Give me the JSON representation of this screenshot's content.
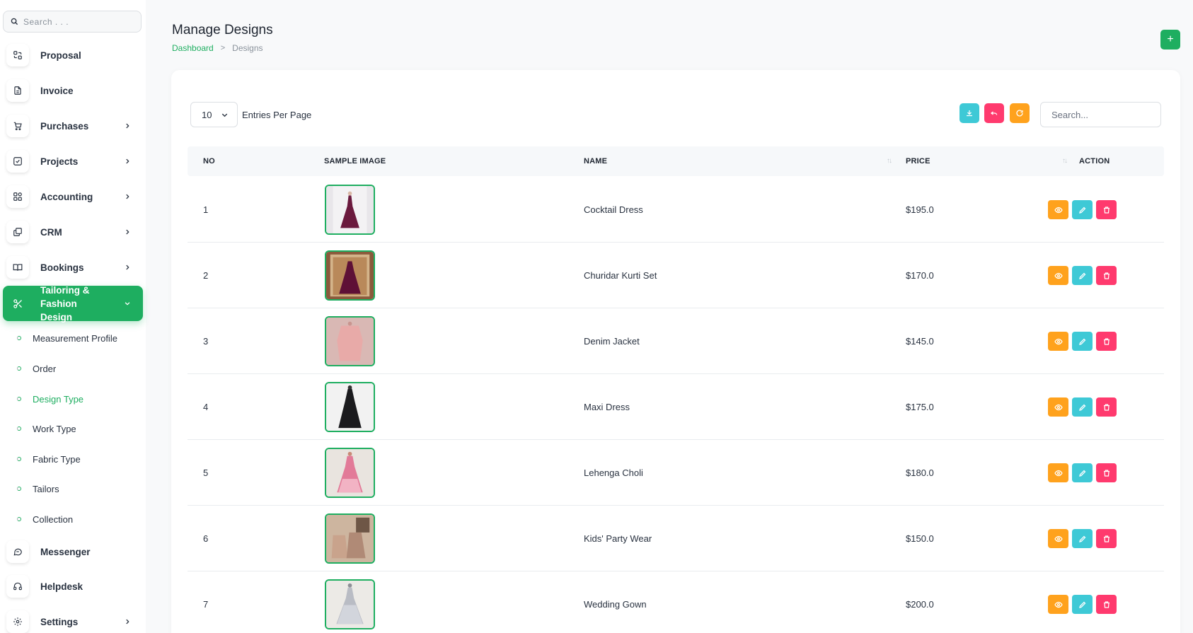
{
  "sidebar": {
    "search_placeholder": "Search . . .",
    "items": [
      {
        "label": "Proposal",
        "icon": "proposal-icon",
        "has_chevron": false
      },
      {
        "label": "Invoice",
        "icon": "invoice-icon",
        "has_chevron": false
      },
      {
        "label": "Purchases",
        "icon": "cart-icon",
        "has_chevron": true
      },
      {
        "label": "Projects",
        "icon": "checkbox-icon",
        "has_chevron": true
      },
      {
        "label": "Accounting",
        "icon": "grid-icon",
        "has_chevron": true
      },
      {
        "label": "CRM",
        "icon": "layers-icon",
        "has_chevron": true
      },
      {
        "label": "Bookings",
        "icon": "book-icon",
        "has_chevron": true
      }
    ],
    "active_item": {
      "label_line1": "Tailoring & Fashion",
      "label_line2": "Design",
      "icon": "scissors-icon"
    },
    "sub_items": [
      "Measurement Profile",
      "Order",
      "Design Type",
      "Work Type",
      "Fabric Type",
      "Tailors",
      "Collection"
    ],
    "active_sub_item": "Design Type",
    "bottom_items": [
      {
        "label": "Messenger",
        "icon": "chat-icon",
        "has_chevron": false
      },
      {
        "label": "Helpdesk",
        "icon": "headset-icon",
        "has_chevron": false
      },
      {
        "label": "Settings",
        "icon": "gear-icon",
        "has_chevron": true
      }
    ]
  },
  "header": {
    "title": "Manage Designs",
    "breadcrumb": {
      "link": "Dashboard",
      "separator": ">",
      "current": "Designs"
    },
    "add_label": "+"
  },
  "table_controls": {
    "entries_value": "10",
    "entries_label": "Entries Per Page",
    "search_placeholder": "Search...",
    "buttons": [
      {
        "name": "export-button",
        "icon": "download-icon",
        "color": "#3ec9d6"
      },
      {
        "name": "undo-button",
        "icon": "undo-icon",
        "color": "#ff3a6e"
      },
      {
        "name": "refresh-button",
        "icon": "refresh-icon",
        "color": "#ffa21d"
      }
    ]
  },
  "table": {
    "columns": [
      "NO",
      "SAMPLE IMAGE",
      "NAME",
      "PRICE",
      "ACTION"
    ],
    "rows": [
      {
        "no": "1",
        "name": "Cocktail Dress",
        "price": "$195.0",
        "image": "cocktail-dress-photo"
      },
      {
        "no": "2",
        "name": "Churidar Kurti Set",
        "price": "$170.0",
        "image": "churidar-kurti-photo"
      },
      {
        "no": "3",
        "name": "Denim Jacket",
        "price": "$145.0",
        "image": "denim-jacket-photo"
      },
      {
        "no": "4",
        "name": "Maxi Dress",
        "price": "$175.0",
        "image": "maxi-dress-photo"
      },
      {
        "no": "5",
        "name": "Lehenga Choli",
        "price": "$180.0",
        "image": "lehenga-choli-photo"
      },
      {
        "no": "6",
        "name": "Kids' Party Wear",
        "price": "$150.0",
        "image": "kids-party-wear-photo"
      },
      {
        "no": "7",
        "name": "Wedding Gown",
        "price": "$200.0",
        "image": "wedding-gown-photo"
      }
    ],
    "action_buttons": [
      {
        "name": "view-button",
        "icon": "eye-icon",
        "color": "#ffa21d"
      },
      {
        "name": "edit-button",
        "icon": "pencil-icon",
        "color": "#3ec9d6"
      },
      {
        "name": "delete-button",
        "icon": "trash-icon",
        "color": "#ff3a6e"
      }
    ]
  },
  "colors": {
    "accent": "#1eae60",
    "info": "#3ec9d6",
    "danger": "#ff3a6e",
    "warning": "#ffa21d"
  }
}
